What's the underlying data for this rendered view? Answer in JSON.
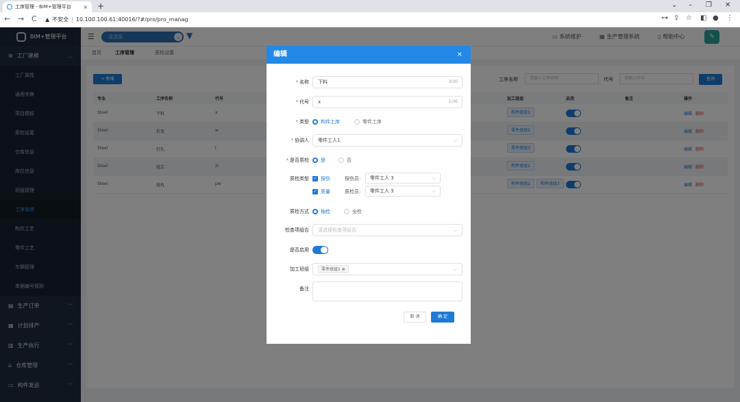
{
  "browser": {
    "tab_title": "工序管理 - BIM+管理平台",
    "tab_close": "×",
    "new_tab": "+",
    "security": "不安全",
    "url": "10.100.100.61:40016/?#/pro/pro_manag",
    "nav_back": "←",
    "nav_forward": "→",
    "nav_reload": "C",
    "warn_icon": "▲",
    "win_collapse": "⌄",
    "win_min": "–",
    "win_max": "❐",
    "win_close": "✕",
    "key_icon": "⊶",
    "share_icon": "⇪",
    "star_icon": "☆",
    "panel_icon": "◧",
    "profile_icon": "●",
    "menu_icon": "⋮"
  },
  "sidebar": {
    "logo": "BIM+管理平台",
    "factory_group": "工厂建模",
    "items": [
      "工厂属性",
      "通用字典",
      "项目模板",
      "质检设置",
      "仓库信息",
      "库位信息",
      "班组管理",
      "工序管理",
      "构件工艺",
      "零件工艺",
      "车辆管理",
      "单据编号规则"
    ],
    "groups": [
      "生产订单",
      "计划排产",
      "生产执行",
      "仓库管理",
      "构件发运"
    ]
  },
  "topbar": {
    "select_placeholder": "请选择",
    "links": [
      "系统维护",
      "生产管理系统",
      "帮助中心"
    ]
  },
  "tags": [
    "首页",
    "工序管理",
    "质检设置"
  ],
  "toolbar": {
    "add": "+ 新增",
    "name_label": "工序名称",
    "name_placeholder": "请输入工序名称",
    "code_label": "代号",
    "code_placeholder": "请输入代号",
    "query": "查询"
  },
  "table": {
    "headers": [
      "专业",
      "工序名称",
      "代号",
      "加工班组",
      "启用",
      "备注",
      "操作"
    ],
    "rows": [
      {
        "major": "Steel",
        "name": "下料",
        "code": "x",
        "teams": [
          "构件班组1"
        ]
      },
      {
        "major": "Steel",
        "name": "折弯",
        "code": "w",
        "teams": [
          "零件班组2"
        ]
      },
      {
        "major": "Steel",
        "name": "打孔",
        "code": "l",
        "teams": [
          "零件班组3"
        ]
      },
      {
        "major": "Steel",
        "name": "组立",
        "code": "zl",
        "teams": [
          "构件班组1"
        ]
      },
      {
        "major": "Steel",
        "name": "抛丸",
        "code": "pw",
        "teams": [
          "构件班组2",
          "构件班组3"
        ]
      }
    ],
    "edit": "编辑",
    "delete": "删除"
  },
  "modal": {
    "title": "编辑",
    "close": "×",
    "name_label": "名称",
    "name_value": "下料",
    "name_count": "3/30",
    "code_label": "代号",
    "code_value": "x",
    "code_count": "1/30",
    "type_label": "类型",
    "type_opt1": "构件工序",
    "type_opt2": "零件工序",
    "coord_label": "协调人",
    "coord_value": "零件工人1",
    "qc_label": "是否质检",
    "qc_yes": "是",
    "qc_no": "否",
    "qc_type_label": "质检类型",
    "qc_type1": "探伤",
    "qc_type1_sub": "探伤员:",
    "qc_type1_val": "零件工人 3",
    "qc_type2": "质量",
    "qc_type2_sub": "质检员:",
    "qc_type2_val": "零件工人 3",
    "qc_method_label": "质检方式",
    "qc_method1": "抽检",
    "qc_method2": "全检",
    "check_label": "检查项组合",
    "check_placeholder": "请选择检查项组合",
    "enable_label": "是否启用",
    "team_label": "加工班组",
    "team_tag": "零件班组1",
    "remark_label": "备注",
    "cancel": "取 消",
    "ok": "确 定"
  }
}
